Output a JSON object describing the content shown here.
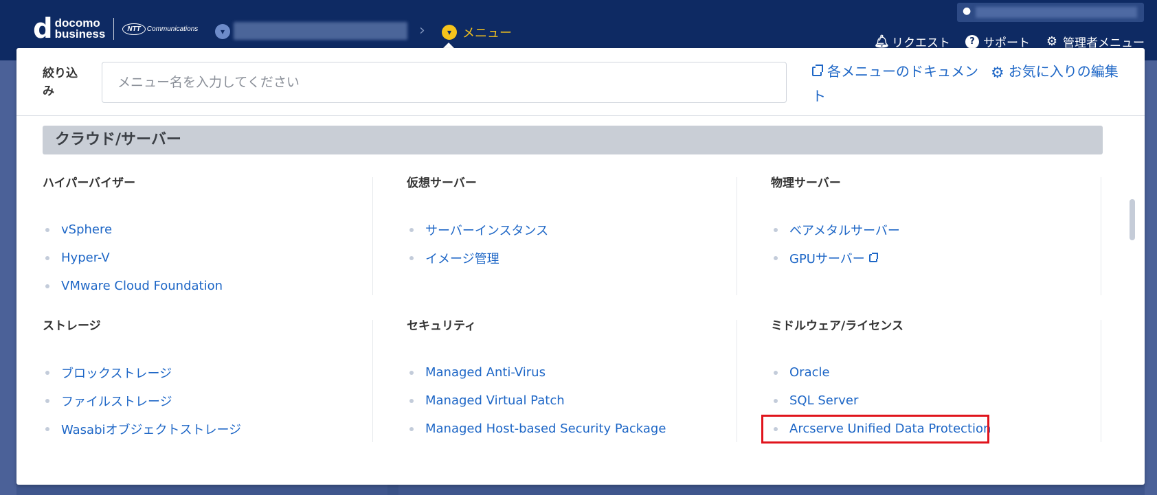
{
  "header": {
    "logo_d": "d",
    "logo_line1": "docomo",
    "logo_line2": "business",
    "partner_logo_oval": "NTT",
    "partner_logo_text": "Communications",
    "breadcrumb_sep": "›",
    "menu_label": "メニュー",
    "links": {
      "request": "リクエスト",
      "support": "サポート",
      "admin": "管理者メニュー"
    }
  },
  "panel": {
    "filter_label": "絞り込み",
    "filter_placeholder": "メニュー名を入力してください",
    "doc_link": "各メニューのドキュメント",
    "fav_link": "お気に入りの編集"
  },
  "section": {
    "title": "クラウド/サーバー",
    "columns": [
      {
        "title": "ハイパーバイザー",
        "items": [
          "vSphere",
          "Hyper-V",
          "VMware Cloud Foundation"
        ]
      },
      {
        "title": "仮想サーバー",
        "items": [
          "サーバーインスタンス",
          "イメージ管理"
        ]
      },
      {
        "title": "物理サーバー",
        "items": [
          "ベアメタルサーバー",
          "GPUサーバー"
        ]
      },
      {
        "title": "ストレージ",
        "items": [
          "ブロックストレージ",
          "ファイルストレージ",
          "Wasabiオブジェクトストレージ"
        ]
      },
      {
        "title": "セキュリティ",
        "items": [
          "Managed Anti-Virus",
          "Managed Virtual Patch",
          "Managed Host-based Security Package"
        ]
      },
      {
        "title": "ミドルウェア/ライセンス",
        "items": [
          "Oracle",
          "SQL Server",
          "Arcserve Unified Data Protection"
        ]
      }
    ]
  },
  "colors": {
    "header_bg": "#0e2a63",
    "accent_yellow": "#f5c31c",
    "link_blue": "#1d66c6",
    "highlight_red": "#e0141c"
  },
  "icons": {
    "breadcrumb": "chevron-down-circle-icon",
    "request": "bell-icon",
    "support": "question-circle-icon",
    "admin": "gear-icon",
    "user": "user-icon"
  }
}
